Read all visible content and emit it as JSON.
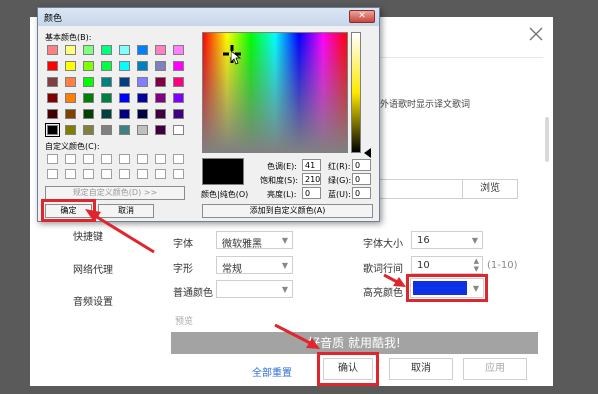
{
  "settings": {
    "nav": [
      "快捷键",
      "网络代理",
      "音频设置"
    ],
    "partial_text": "放外语歌时显示译文歌词",
    "browse_label": "浏览",
    "font_label": "字体",
    "font_value": "微软雅黑",
    "size_label": "字体大小",
    "size_value": "16",
    "style_label": "字形",
    "style_value": "常规",
    "line_spacing_label": "歌词行间",
    "line_spacing_value": "10",
    "line_spacing_range": "(1-10)",
    "normal_color_label": "普通颜色",
    "highlight_color_label": "高亮颜色",
    "highlight_color": "#1030e8",
    "preview_label": "预览",
    "preview_text": "好音质 就用酷我!",
    "reset_all": "全部重置",
    "confirm": "确认",
    "cancel": "取消",
    "apply": "应用"
  },
  "color_dialog": {
    "title": "颜色",
    "close_symbol": "✕",
    "basic_colors_label": "基本颜色(B):",
    "custom_colors_label": "自定义颜色(C):",
    "define_custom_button": "规定自定义颜色(D) >>",
    "ok_button": "确定",
    "cancel_button": "取消",
    "color_solid_label": "颜色|纯色(O)",
    "hue_label": "色调(E):",
    "hue_value": "41",
    "sat_label": "饱和度(S):",
    "sat_value": "210",
    "lum_label": "亮度(L):",
    "lum_value": "0",
    "red_label": "红(R):",
    "red_value": "0",
    "green_label": "绿(G):",
    "green_value": "0",
    "blue_label": "蓝(U):",
    "blue_value": "0",
    "add_custom_button": "添加到自定义颜色(A)",
    "basic_colors": [
      "#ff8080",
      "#ffff80",
      "#80ff80",
      "#00ff80",
      "#80ffff",
      "#0080ff",
      "#ff80c0",
      "#ff80ff",
      "#ff0000",
      "#ffff00",
      "#80ff00",
      "#00ff40",
      "#00ffff",
      "#0080c0",
      "#8080c0",
      "#ff00ff",
      "#804040",
      "#ff8040",
      "#00ff00",
      "#008080",
      "#004080",
      "#8080ff",
      "#800040",
      "#ff0080",
      "#800000",
      "#ff8000",
      "#008000",
      "#008040",
      "#0000ff",
      "#0000a0",
      "#800080",
      "#8000ff",
      "#400000",
      "#804000",
      "#004000",
      "#004040",
      "#000080",
      "#000040",
      "#400040",
      "#400080",
      "#000000",
      "#808000",
      "#808040",
      "#808080",
      "#408080",
      "#c0c0c0",
      "#400040",
      "#ffffff"
    ]
  }
}
